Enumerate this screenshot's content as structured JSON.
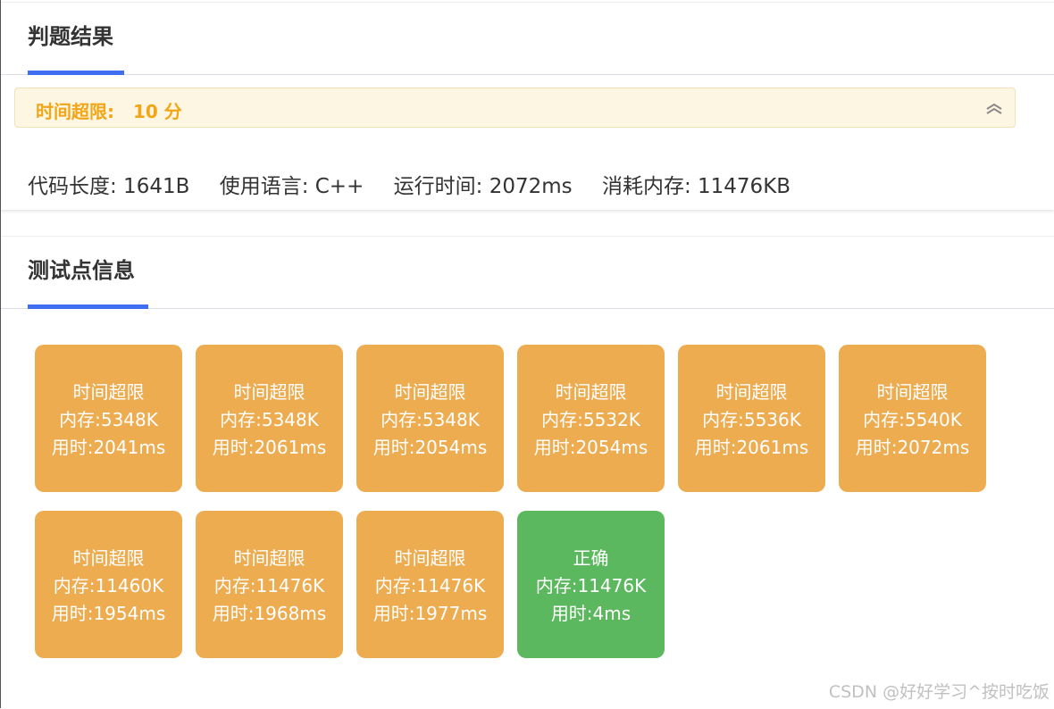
{
  "result_card": {
    "title": "判题结果",
    "banner": {
      "status": "时间超限:",
      "score": "10 分"
    },
    "stats": {
      "code_length": "代码长度: 1641B",
      "language": "使用语言: C++",
      "run_time": "运行时间: 2072ms",
      "memory": "消耗内存: 11476KB"
    }
  },
  "testcase_card": {
    "title": "测试点信息",
    "cases": [
      {
        "status": "时间超限",
        "memory": "内存:5348K",
        "time": "用时:2041ms",
        "result": "tle"
      },
      {
        "status": "时间超限",
        "memory": "内存:5348K",
        "time": "用时:2061ms",
        "result": "tle"
      },
      {
        "status": "时间超限",
        "memory": "内存:5348K",
        "time": "用时:2054ms",
        "result": "tle"
      },
      {
        "status": "时间超限",
        "memory": "内存:5532K",
        "time": "用时:2054ms",
        "result": "tle"
      },
      {
        "status": "时间超限",
        "memory": "内存:5536K",
        "time": "用时:2061ms",
        "result": "tle"
      },
      {
        "status": "时间超限",
        "memory": "内存:5540K",
        "time": "用时:2072ms",
        "result": "tle"
      },
      {
        "status": "时间超限",
        "memory": "内存:11460K",
        "time": "用时:1954ms",
        "result": "tle"
      },
      {
        "status": "时间超限",
        "memory": "内存:11476K",
        "time": "用时:1968ms",
        "result": "tle"
      },
      {
        "status": "时间超限",
        "memory": "内存:11476K",
        "time": "用时:1977ms",
        "result": "tle"
      },
      {
        "status": "正确",
        "memory": "内存:11476K",
        "time": "用时:4ms",
        "result": "ac"
      }
    ]
  },
  "watermark": "CSDN @好好学习^按时吃饭",
  "colors": {
    "accent": "#3f6ff0",
    "warning": "#f2a516",
    "tle": "#eeac51",
    "ac": "#5cb85f"
  },
  "icons": {
    "collapse": "double-chevron-up-icon"
  }
}
